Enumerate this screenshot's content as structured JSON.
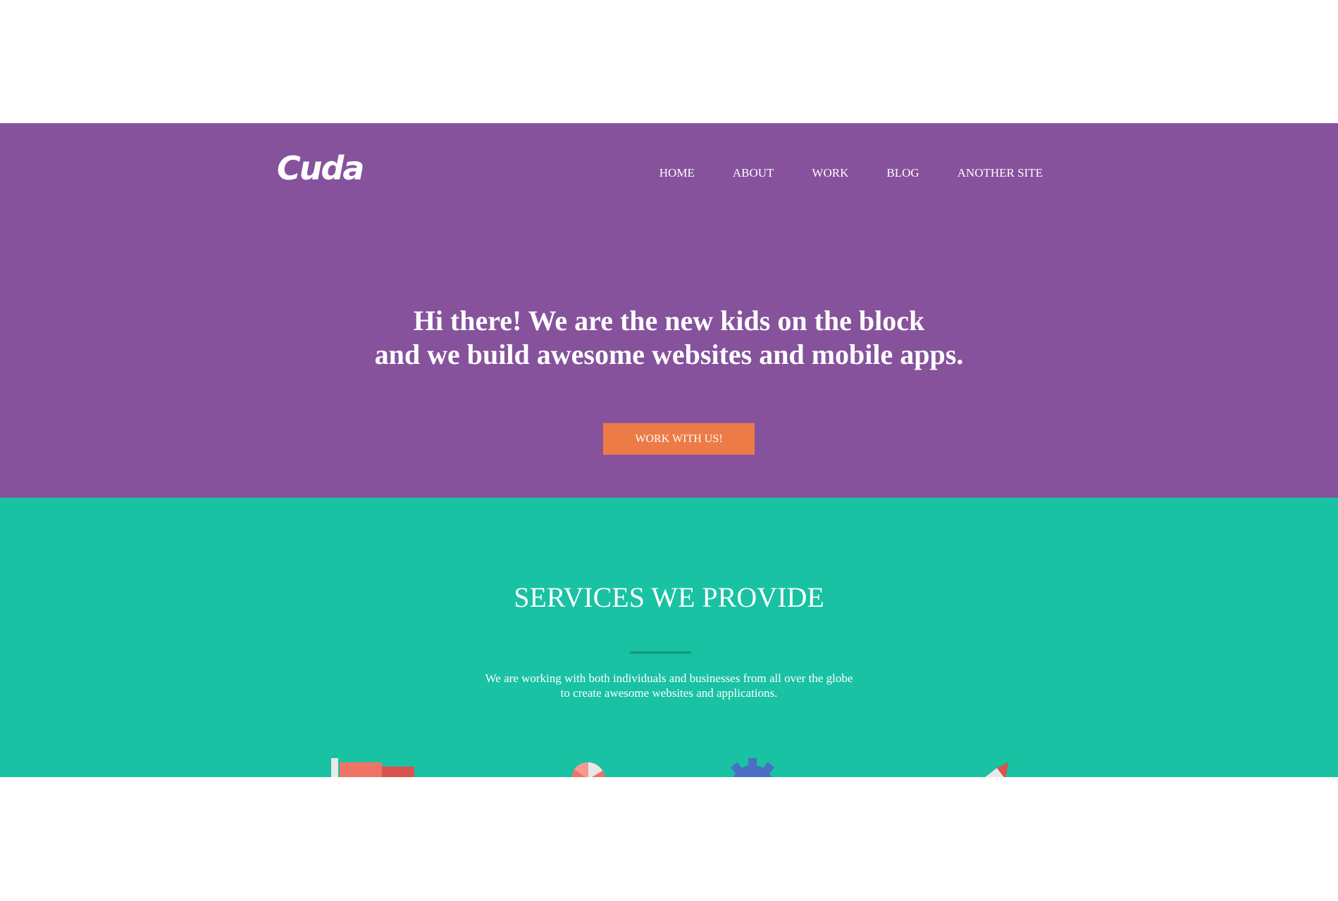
{
  "logo": {
    "text": "Cuda"
  },
  "nav": [
    "HOME",
    "ABOUT",
    "WORK",
    "BLOG",
    "ANOTHER SITE"
  ],
  "hero": {
    "line1": "Hi there! We are the new kids on the block",
    "line2": "and we build awesome websites and mobile apps.",
    "cta": "WORK WITH US!"
  },
  "services": {
    "title": "SERVICES WE PROVIDE",
    "desc_line1": "We are working with both individuals and businesses from all over the globe",
    "desc_line2": "to create awesome websites and applications.",
    "icons": [
      "ruler-icon",
      "pie-chart-icon",
      "gear-icon",
      "rocket-icon"
    ]
  },
  "colors": {
    "hero_bg": "#86529c",
    "services_bg": "#18c2a3",
    "cta_bg": "#ec7b48"
  }
}
